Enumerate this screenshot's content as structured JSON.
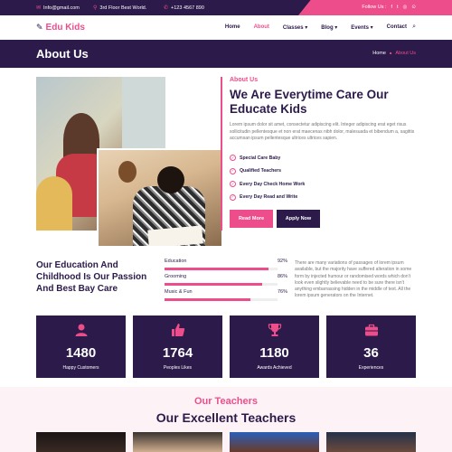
{
  "topbar": {
    "email": "Info@gmail.com",
    "address": "3rd Floor Best World.",
    "phone": "+123 4567 890",
    "follow_label": "Follow Us :",
    "social": [
      "f",
      "t",
      "◎",
      "⊙"
    ]
  },
  "header": {
    "logo_text": "Edu Kids",
    "nav": [
      {
        "label": "Home"
      },
      {
        "label": "About"
      },
      {
        "label": "Classes ▾"
      },
      {
        "label": "Blog ▾"
      },
      {
        "label": "Events ▾"
      },
      {
        "label": "Contact"
      }
    ],
    "active_index": 1
  },
  "page": {
    "title": "About Us",
    "breadcrumb": {
      "home": "Home",
      "sep": "■",
      "current": "About Us"
    }
  },
  "about": {
    "eyebrow": "About Us",
    "title": "We Are Everytime Care Our Educate Kids",
    "paragraph": "Lorem ipsum dolor sit amet, consectetur adipiscing elit. Integer adipiscing erat eget risus sollicitudin pellentesque et non erat maecenas nibh dolor, malesuada et bibendum a, sagittis accumsan ipsum pellentesque ultrices ultrices sapien.",
    "features": [
      "Special Care Baby",
      "Qualified Teachers",
      "Every Day Check Home Work",
      "Every Day Read and Write"
    ],
    "btn_primary": "Read More",
    "btn_secondary": "Apply Now"
  },
  "education": {
    "title": "Our Education And Childhood Is Our Passion And Best Bay Care",
    "skills": [
      {
        "label": "Education",
        "pct_text": "92%",
        "value": 0.92
      },
      {
        "label": "Grooming",
        "pct_text": "86%",
        "value": 0.86
      },
      {
        "label": "Music & Fun",
        "pct_text": "76%",
        "value": 0.76
      }
    ],
    "paragraph": "There are many variations of passages of lorem ipsum available, but the majority have suffered alteration in some form by injected humour or randomised words which don't look even slightly believable need to be sure there isn't anything embarrassing hidden in the middle of text. All the lorem ipsum generators on the Internet."
  },
  "stats": [
    {
      "number": "1480",
      "label": "Happy Customers",
      "icon": "user-icon"
    },
    {
      "number": "1764",
      "label": "Peoples Likes",
      "icon": "thumbs-up-icon"
    },
    {
      "number": "1180",
      "label": "Awards Achieved",
      "icon": "trophy-icon"
    },
    {
      "number": "36",
      "label": "Experiences",
      "icon": "briefcase-icon"
    }
  ],
  "teachers": {
    "eyebrow": "Our Teachers",
    "title": "Our Excellent Teachers"
  },
  "colors": {
    "primary": "#2b1a4a",
    "accent": "#ee4d8b"
  }
}
